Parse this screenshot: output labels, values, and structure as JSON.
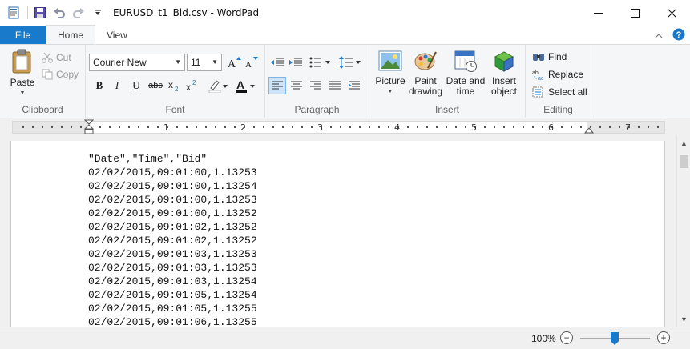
{
  "window": {
    "title": "EURUSD_t1_Bid.csv - WordPad",
    "controls": [
      "minimize",
      "maximize",
      "close"
    ]
  },
  "quick_access": [
    "save",
    "undo",
    "redo",
    "customize"
  ],
  "tabs": [
    {
      "label": "File",
      "active": false
    },
    {
      "label": "Home",
      "active": true
    },
    {
      "label": "View",
      "active": false
    }
  ],
  "ribbon": {
    "clipboard": {
      "label": "Clipboard",
      "paste": "Paste",
      "cut": "Cut",
      "copy": "Copy"
    },
    "font": {
      "label": "Font",
      "family": "Courier New",
      "size": "11"
    },
    "paragraph": {
      "label": "Paragraph"
    },
    "insert": {
      "label": "Insert",
      "picture": "Picture",
      "paint_line1": "Paint",
      "paint_line2": "drawing",
      "datetime_line1": "Date and",
      "datetime_line2": "time",
      "object_line1": "Insert",
      "object_line2": "object"
    },
    "editing": {
      "label": "Editing",
      "find": "Find",
      "replace": "Replace",
      "select_all": "Select all"
    }
  },
  "ruler": {
    "numbers": [
      "1",
      "2",
      "3",
      "4",
      "5",
      "6",
      "7"
    ]
  },
  "document": {
    "lines": [
      "\"Date\",\"Time\",\"Bid\"",
      "02/02/2015,09:01:00,1.13253",
      "02/02/2015,09:01:00,1.13254",
      "02/02/2015,09:01:00,1.13253",
      "02/02/2015,09:01:00,1.13252",
      "02/02/2015,09:01:02,1.13252",
      "02/02/2015,09:01:02,1.13252",
      "02/02/2015,09:01:03,1.13253",
      "02/02/2015,09:01:03,1.13253",
      "02/02/2015,09:01:03,1.13254",
      "02/02/2015,09:01:05,1.13254",
      "02/02/2015,09:01:05,1.13255",
      "02/02/2015,09:01:06,1.13255"
    ]
  },
  "status": {
    "zoom": "100%",
    "zoom_level": 1.0
  },
  "colors": {
    "accent": "#1979ca",
    "ribbon_bg": "#f5f6f7",
    "selected_bg": "#cce4f7"
  }
}
